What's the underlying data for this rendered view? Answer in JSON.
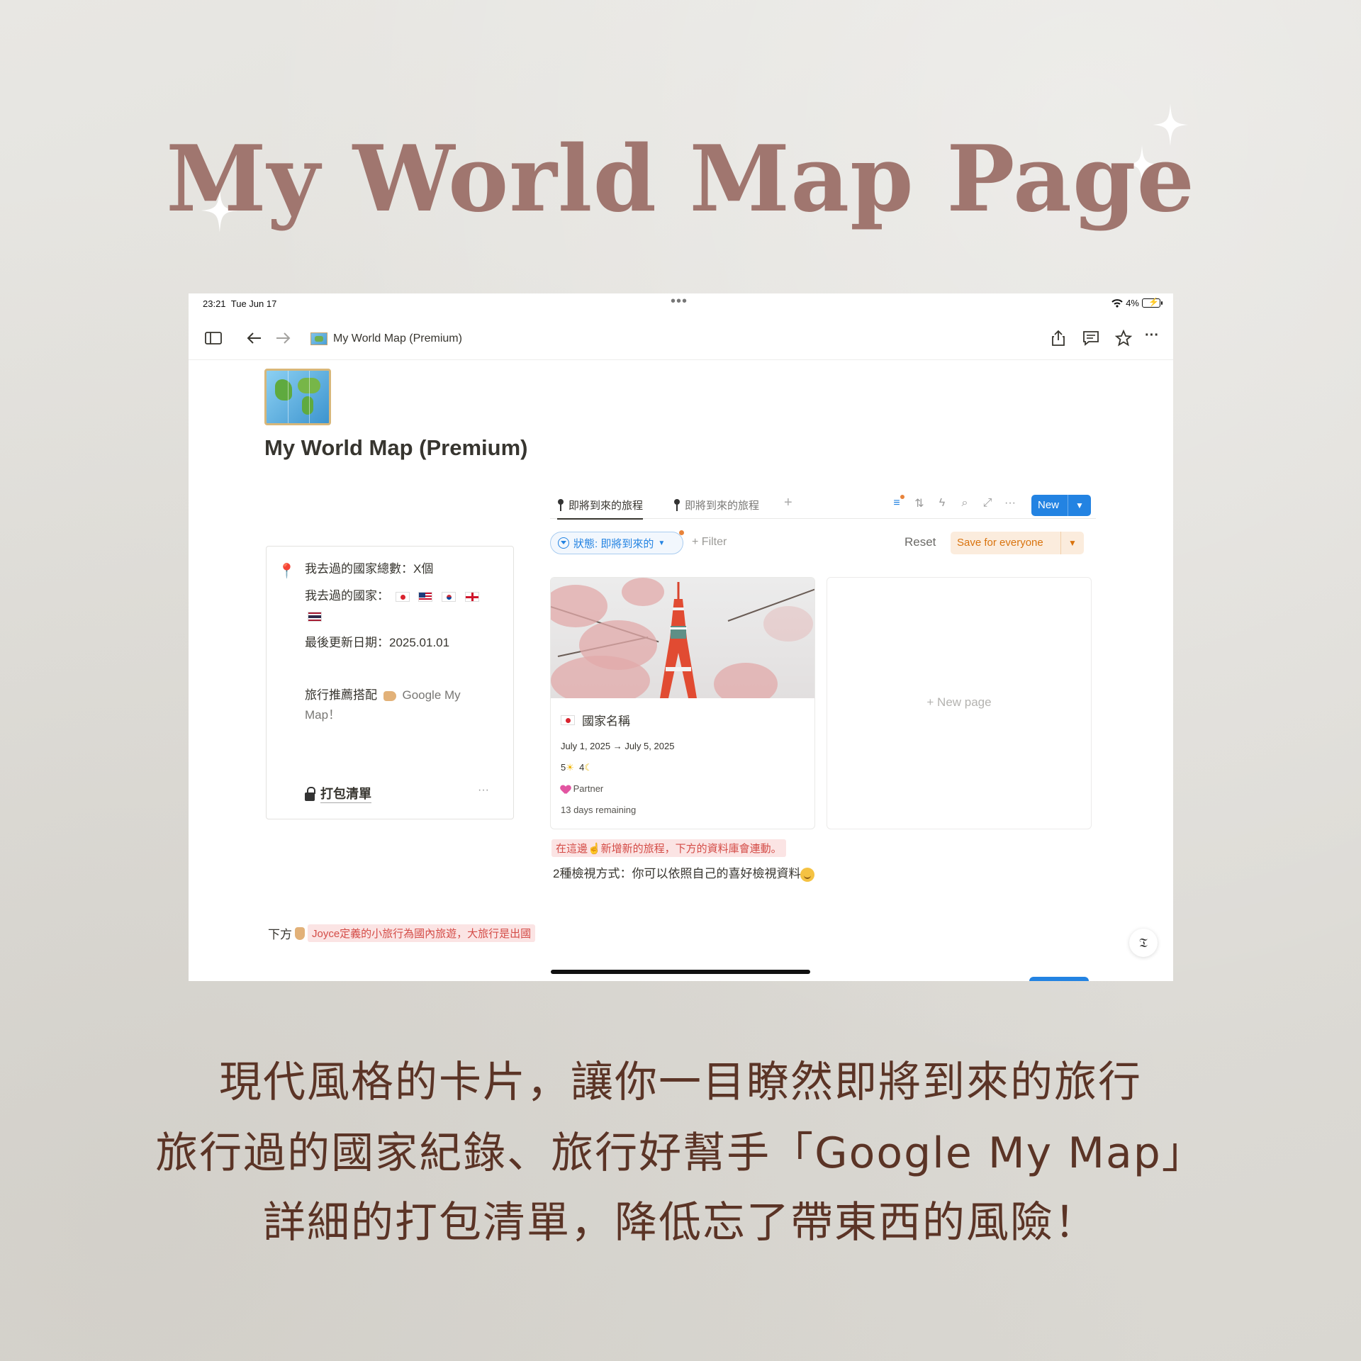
{
  "hero_title": "My World Map Page",
  "status_bar": {
    "time": "23:21",
    "date": "Tue Jun 17",
    "battery": "4%"
  },
  "topbar": {
    "page_title": "My World Map (Premium)"
  },
  "page": {
    "title": "My World Map (Premium)"
  },
  "callout": {
    "countries_total": "我去過的國家總數：X個",
    "countries_label": "我去過的國家：",
    "last_updated": "最後更新日期：2025.01.01",
    "recommend": "旅行推薦搭配",
    "recommend_link": "Google My Map！",
    "packing_list": "打包清單"
  },
  "database": {
    "tabs": [
      {
        "label": "即將到來的旅程"
      },
      {
        "label": "即將到來的旅程"
      }
    ],
    "new_button": "New",
    "filter_pill": "狀態: 即將到來的",
    "add_filter": "+ Filter",
    "reset": "Reset",
    "save_for_everyone": "Save for everyone",
    "card": {
      "name": "國家名稱",
      "dates": "July 1, 2025 → July 5, 2025",
      "days": "5",
      "nights": "4",
      "companion": "Partner",
      "remaining": "13 days remaining"
    },
    "new_page": "+ New page"
  },
  "notes": {
    "add_trip": "在這邊☝️新增新的旅程，下方的資料庫會連動。",
    "views": "2種檢視方式：你可以依照自己的喜好檢視資料",
    "below_prefix": "下方",
    "below_red": "Joyce定義的小旅行為國內旅遊，大旅行是出國"
  },
  "captions": [
    "現代風格的卡片，讓你一目瞭然即將到來的旅行",
    "旅行過的國家紀錄、旅行好幫手「Google My Map」",
    "詳細的打包清單，降低忘了帶東西的風險！"
  ],
  "colors": {
    "title": "#a0766f",
    "caption": "#5b3426",
    "accent_blue": "#2383e2",
    "save_orange": "#d9730d"
  },
  "icons": {
    "sidebar": "sidebar-icon",
    "back": "arrow-left-icon",
    "forward": "arrow-right-icon",
    "share": "share-icon",
    "comment": "comment-icon",
    "favorite": "star-icon",
    "more": "more-icon"
  }
}
